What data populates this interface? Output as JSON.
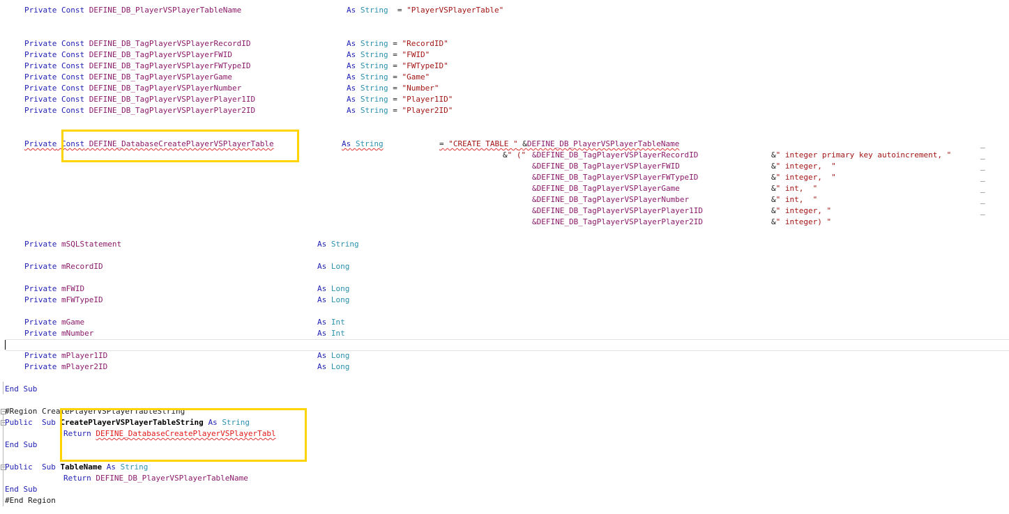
{
  "k": {
    "private": "Private",
    "const": "Const",
    "as": "As",
    "string": "String",
    "long": "Long",
    "int": "Int",
    "public": "Public",
    "sub": "Sub",
    "return": "Return",
    "end_sub": "End Sub",
    "region": "#Region",
    "end_region": "#End Region",
    "eq": "=",
    "amp": "&",
    "cont": "_"
  },
  "table_name_const": {
    "name": "DEFINE_DB_PlayerVSPlayerTableName",
    "value": "\"PlayerVSPlayerTable\""
  },
  "tag_consts": [
    {
      "name": "DEFINE_DB_TagPlayerVSPlayerRecordID",
      "value": "\"RecordID\""
    },
    {
      "name": "DEFINE_DB_TagPlayerVSPlayerFWID",
      "value": "\"FWID\""
    },
    {
      "name": "DEFINE_DB_TagPlayerVSPlayerFWTypeID",
      "value": "\"FWTypeID\""
    },
    {
      "name": "DEFINE_DB_TagPlayerVSPlayerGame",
      "value": "\"Game\""
    },
    {
      "name": "DEFINE_DB_TagPlayerVSPlayerNumber",
      "value": "\"Number\""
    },
    {
      "name": "DEFINE_DB_TagPlayerVSPlayerPlayer1ID",
      "value": "\"Player1ID\""
    },
    {
      "name": "DEFINE_DB_TagPlayerVSPlayerPlayer2ID",
      "value": "\"Player2ID\""
    }
  ],
  "create_const": {
    "name": "DEFINE_DatabaseCreatePlayerVSPlayerTable",
    "create_str": "\"CREATE TABLE \"",
    "table_ref": "DEFINE_DB_PlayerVSPlayerTableName",
    "open_str": "\" (\"",
    "rows": [
      {
        "tag": "&DEFINE_DB_TagPlayerVSPlayerRecordID",
        "sql": "\" integer primary key autoincrement, \""
      },
      {
        "tag": "&DEFINE_DB_TagPlayerVSPlayerFWID",
        "sql": "\" integer,  \""
      },
      {
        "tag": "&DEFINE_DB_TagPlayerVSPlayerFWTypeID",
        "sql": "\" integer,  \""
      },
      {
        "tag": "&DEFINE_DB_TagPlayerVSPlayerGame",
        "sql": "\" int,  \""
      },
      {
        "tag": "&DEFINE_DB_TagPlayerVSPlayerNumber",
        "sql": "\" int,  \""
      },
      {
        "tag": "&DEFINE_DB_TagPlayerVSPlayerPlayer1ID",
        "sql": "\" integer, \""
      },
      {
        "tag": "&DEFINE_DB_TagPlayerVSPlayerPlayer2ID",
        "sql": "\" integer) \""
      }
    ]
  },
  "members": {
    "sql": {
      "name": "mSQLStatement",
      "type": "String"
    },
    "record": {
      "name": "mRecordID",
      "type": "Long"
    },
    "fwid": {
      "name": "mFWID",
      "type": "Long"
    },
    "fwtype": {
      "name": "mFWTypeID",
      "type": "Long"
    },
    "game": {
      "name": "mGame",
      "type": "Int"
    },
    "number": {
      "name": "mNumber",
      "type": "Int"
    },
    "p1": {
      "name": "mPlayer1ID",
      "type": "Long"
    },
    "p2": {
      "name": "mPlayer2ID",
      "type": "Long"
    }
  },
  "region": {
    "name": "CreatePlayerVSPlayerTableString",
    "sub1_name": "CreatePlayerVSPlayerTableString",
    "sub1_return": "DEFINE_DatabaseCreatePlayerVSPlayerTabl",
    "sub2_name": "TableName",
    "sub2_return": "DEFINE_DB_PlayerVSPlayerTableName"
  },
  "colors": {
    "keyword": "#1e1eb4",
    "identifier": "#8b1a6b",
    "type": "#2b91af",
    "string": "#a31515",
    "error": "#e01818",
    "highlight": "#ffd400"
  }
}
